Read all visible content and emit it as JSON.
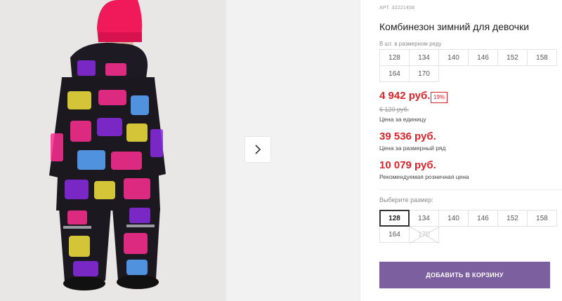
{
  "product": {
    "sku": "АРТ. 32221458",
    "title": "Комбинезон зимний для девочки",
    "row_label": "В шт. в размерном ряду",
    "row_sizes": [
      "128",
      "134",
      "140",
      "146",
      "152",
      "158",
      "164",
      "170"
    ]
  },
  "pricing": {
    "price": "4 942 руб.",
    "discount": "19%",
    "old_price": "6 120 руб.",
    "unit_caption": "Цена за единицу",
    "row_price": "39 536 руб.",
    "row_caption": "Цена за размерный ряд",
    "retail_price": "10 079 руб.",
    "retail_caption": "Рекомендуемая розничная цена"
  },
  "size_select": {
    "label": "Выберите размер:",
    "options": [
      {
        "label": "128",
        "state": "selected"
      },
      {
        "label": "134",
        "state": "available"
      },
      {
        "label": "140",
        "state": "available"
      },
      {
        "label": "146",
        "state": "available"
      },
      {
        "label": "152",
        "state": "available"
      },
      {
        "label": "158",
        "state": "available"
      },
      {
        "label": "164",
        "state": "available"
      },
      {
        "label": "170",
        "state": "unavailable"
      }
    ]
  },
  "cart_button": "ДОБАВИТЬ В КОРЗИНУ",
  "icons": {
    "next": "chevron-right-icon"
  },
  "colors": {
    "accent": "#7c5f9e",
    "price": "#d8232a",
    "beanie": "#f0195a"
  }
}
